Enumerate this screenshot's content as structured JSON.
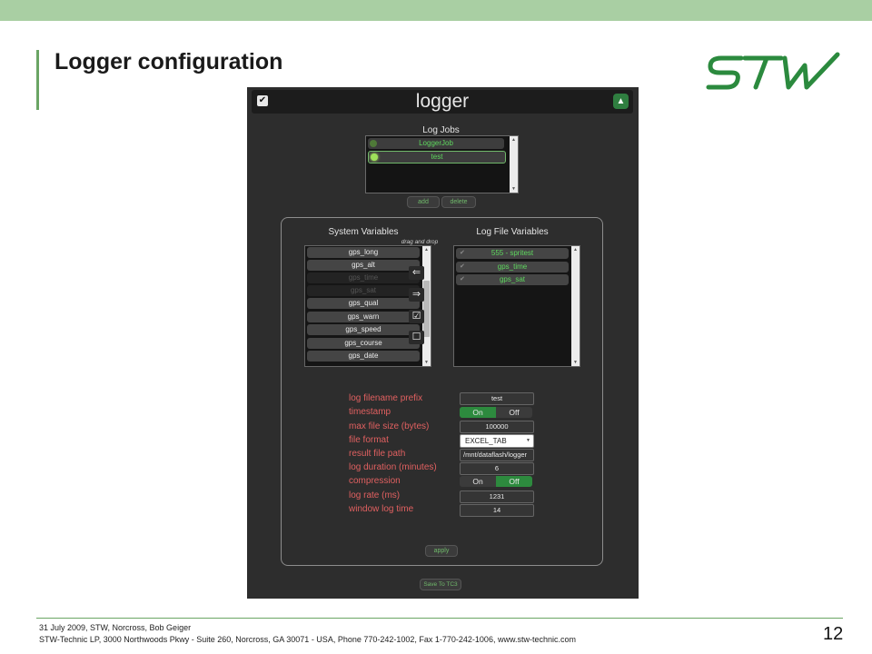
{
  "slide": {
    "title": "Logger configuration",
    "page_number": "12",
    "footer_line1": "31 July 2009, STW, Norcross, Bob Geiger",
    "footer_line2": "STW-Technic LP, 3000 Northwoods Pkwy - Suite 260, Norcross, GA 30071 - USA, Phone 770-242-1002, Fax 1-770-242-1006, www.stw-technic.com",
    "logo_text": "STW"
  },
  "app": {
    "title": "logger",
    "log_jobs_label": "Log Jobs",
    "jobs": [
      "LoggerJob",
      "test"
    ],
    "add_label": "add",
    "delete_label": "delete",
    "system_variables_label": "System Variables",
    "drag_drop_label": "drag and drop",
    "log_file_variables_label": "Log File Variables",
    "system_variables": [
      {
        "name": "gps_long",
        "enabled": true
      },
      {
        "name": "gps_alt",
        "enabled": true
      },
      {
        "name": "gps_time",
        "enabled": false
      },
      {
        "name": "gps_sat",
        "enabled": false
      },
      {
        "name": "gps_qual",
        "enabled": true
      },
      {
        "name": "gps_warn",
        "enabled": true
      },
      {
        "name": "gps_speed",
        "enabled": true
      },
      {
        "name": "gps_course",
        "enabled": true
      },
      {
        "name": "gps_date",
        "enabled": true
      }
    ],
    "log_file_variables": [
      "555 - spritest",
      "gps_time",
      "gps_sat"
    ],
    "properties": {
      "filename_prefix_label": "log filename prefix",
      "filename_prefix": "test",
      "timestamp_label": "timestamp",
      "timestamp_on": "On",
      "timestamp_off": "Off",
      "max_file_size_label": "max file size (bytes)",
      "max_file_size": "100000",
      "file_format_label": "file format",
      "file_format": "EXCEL_TAB",
      "result_file_path_label": "result file path",
      "result_file_path": "/mnt/dataflash/logger",
      "log_duration_label": "log duration (minutes)",
      "log_duration": "6",
      "compression_label": "compression",
      "compression_on": "On",
      "compression_off": "Off",
      "log_rate_label": "log rate (ms)",
      "log_rate": "1231",
      "window_log_time_label": "window log time",
      "window_log_time": "14"
    },
    "apply_label": "apply",
    "save_label": "Save To TC3"
  },
  "colors": {
    "accent_green": "#6aa564",
    "topbar": "#a9cfa3",
    "toggle_active": "#2d8a3e",
    "label_red": "#e06060"
  }
}
